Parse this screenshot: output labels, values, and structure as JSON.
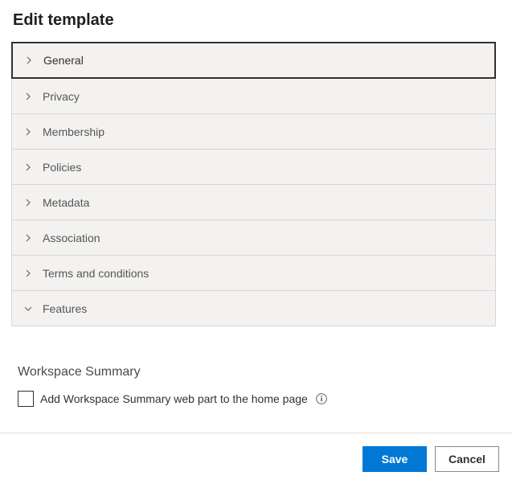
{
  "title": "Edit template",
  "accordion": [
    {
      "label": "General",
      "expanded": false,
      "focused": true
    },
    {
      "label": "Privacy",
      "expanded": false,
      "focused": false
    },
    {
      "label": "Membership",
      "expanded": false,
      "focused": false
    },
    {
      "label": "Policies",
      "expanded": false,
      "focused": false
    },
    {
      "label": "Metadata",
      "expanded": false,
      "focused": false
    },
    {
      "label": "Association",
      "expanded": false,
      "focused": false
    },
    {
      "label": "Terms and conditions",
      "expanded": false,
      "focused": false
    },
    {
      "label": "Features",
      "expanded": true,
      "focused": false
    }
  ],
  "workspace_summary": {
    "title": "Workspace Summary",
    "checkbox_label": "Add Workspace Summary web part to the home page",
    "checked": false
  },
  "footer": {
    "save": "Save",
    "cancel": "Cancel"
  }
}
